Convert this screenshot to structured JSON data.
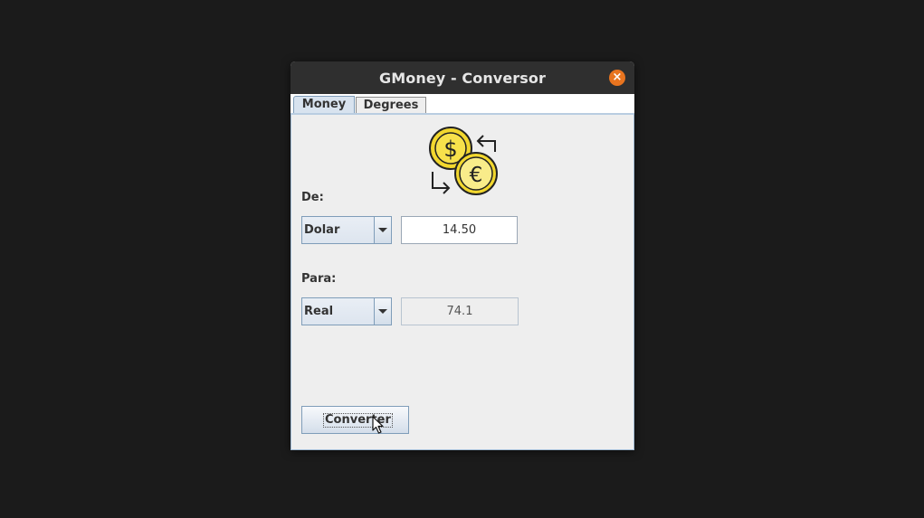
{
  "window": {
    "title": "GMoney - Conversor",
    "close_icon": "×"
  },
  "tabs": [
    {
      "label": "Money",
      "selected": true
    },
    {
      "label": "Degrees",
      "selected": false
    }
  ],
  "logo": {
    "icon": "currency-exchange-icon",
    "symbols": [
      "$",
      "€"
    ]
  },
  "from": {
    "label": "De:",
    "currency": "Dolar",
    "amount": "14.50"
  },
  "to": {
    "label": "Para:",
    "currency": "Real",
    "amount": "74.1"
  },
  "convert_button": {
    "label": "Converter"
  },
  "colors": {
    "titlebar": "#2f2f2f",
    "close_button": "#e8741f",
    "coin_fill": "#f7e14b",
    "coin_inner": "#f9ec8a"
  }
}
